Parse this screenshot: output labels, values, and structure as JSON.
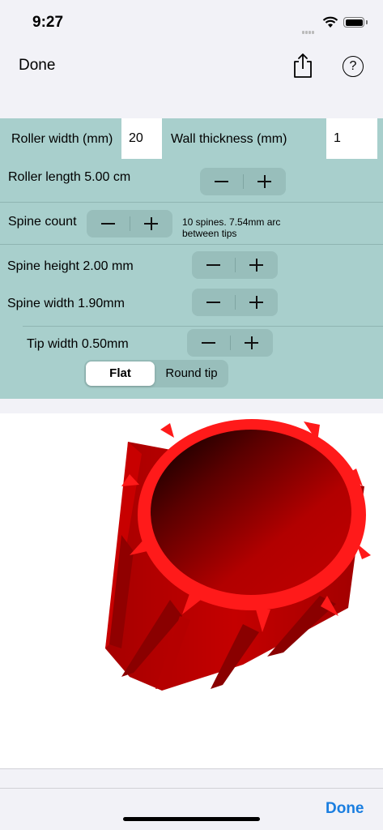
{
  "status_bar": {
    "time": "9:27"
  },
  "nav": {
    "done_label": "Done",
    "help_label": "?"
  },
  "settings": {
    "roller_width_label": "Roller width (mm)",
    "roller_width_value": "20",
    "wall_thickness_label": "Wall thickness (mm)",
    "wall_thickness_value": "1",
    "roller_length_label": "Roller length 5.00 cm",
    "spine_count_label": "Spine count",
    "spine_info_line1": "10 spines. 7.54mm arc",
    "spine_info_line2": "between tips",
    "spine_height_label": "Spine height 2.00 mm",
    "spine_width_label": "Spine width 1.90mm",
    "tip_width_label": "Tip width 0.50mm",
    "tip_shape": {
      "options": [
        "Flat",
        "Round tip"
      ],
      "selected": "Flat"
    }
  },
  "model_preview": {
    "color": "#cc0000",
    "spine_count": 10
  },
  "toolbar": {
    "done_label": "Done"
  },
  "colors": {
    "panel": "#a8cfcc",
    "accent": "#1a7ee0",
    "model": "#cc0000"
  }
}
